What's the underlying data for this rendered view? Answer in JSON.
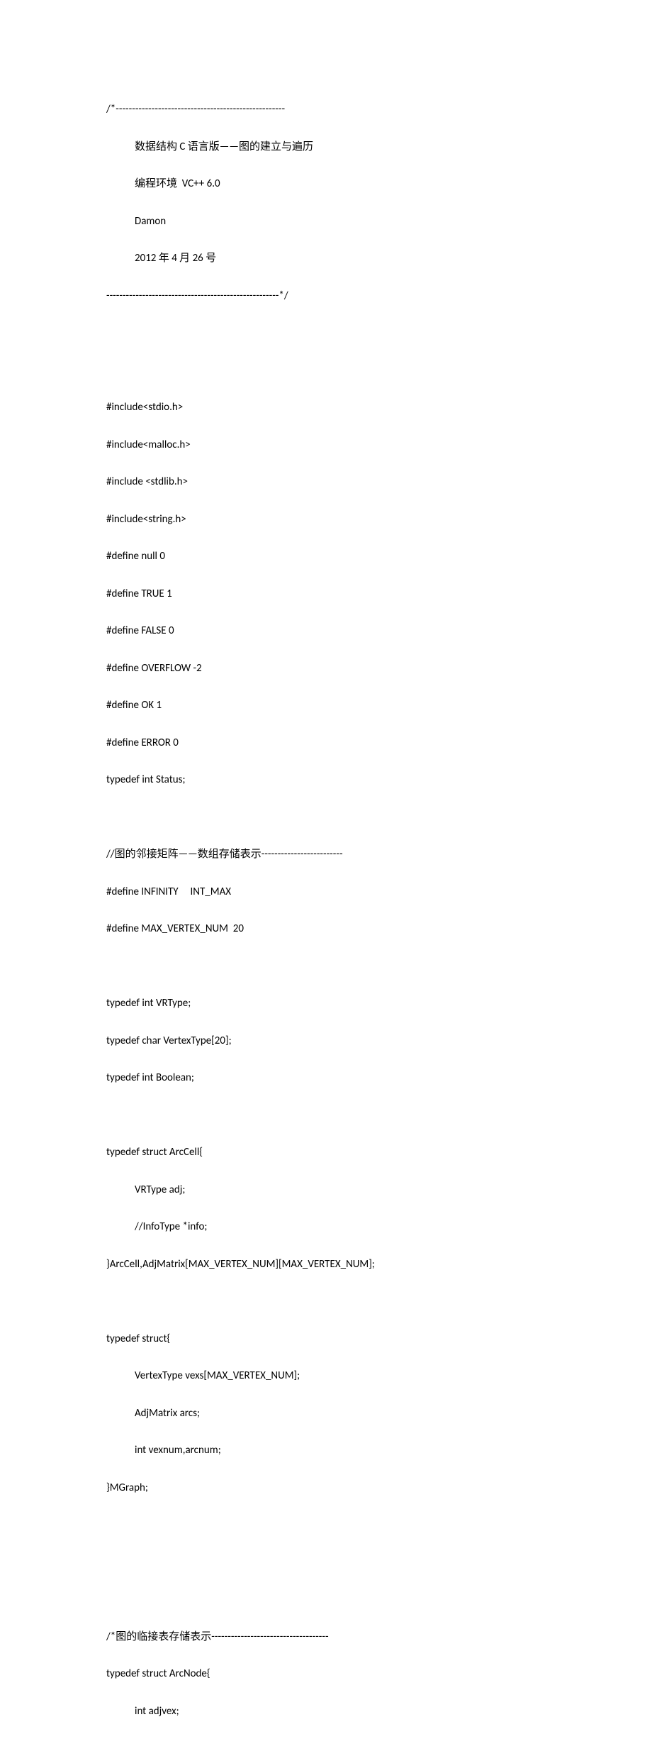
{
  "code": {
    "l01": "/*----------------------------------------------------",
    "l02": "数据结构 C 语言版——图的建立与遍历",
    "l03": "编程环境  VC++ 6.0",
    "l04": "Damon",
    "l05": "2012 年 4 月 26 号",
    "l06": "-----------------------------------------------------*/",
    "blank1": "",
    "blank2": "",
    "l07": "#include<stdio.h>",
    "l08": "#include<malloc.h>",
    "l09": "#include <stdlib.h>",
    "l10": "#include<string.h>",
    "l11": "#define null 0",
    "l12": "#define TRUE 1",
    "l13": "#define FALSE 0",
    "l14": "#define OVERFLOW -2",
    "l15": "#define OK 1",
    "l16": "#define ERROR 0",
    "l17": "typedef int Status;",
    "blank3": "",
    "l18": "//图的邻接矩阵——数组存储表示-------------------------",
    "l19": "#define INFINITY     INT_MAX",
    "l20": "#define MAX_VERTEX_NUM  20",
    "blank4": "",
    "l21": "typedef int VRType;",
    "l22": "typedef char VertexType[20];",
    "l23": "typedef int Boolean;",
    "blank5": "",
    "l24": "typedef struct ArcCell{",
    "l25": "VRType adj;",
    "l26": "//InfoType *info;",
    "l27": "}ArcCell,AdjMatrix[MAX_VERTEX_NUM][MAX_VERTEX_NUM];",
    "blank6": "",
    "l28": "typedef struct{",
    "l29": "VertexType vexs[MAX_VERTEX_NUM];",
    "l30": "AdjMatrix arcs;",
    "l31": "int vexnum,arcnum;",
    "l32": "}MGraph;",
    "blank7": "",
    "blank8": "",
    "blank9": "",
    "l33": "/*图的临接表存储表示------------------------------------",
    "l34": "typedef struct ArcNode{",
    "l35": "int adjvex;"
  }
}
